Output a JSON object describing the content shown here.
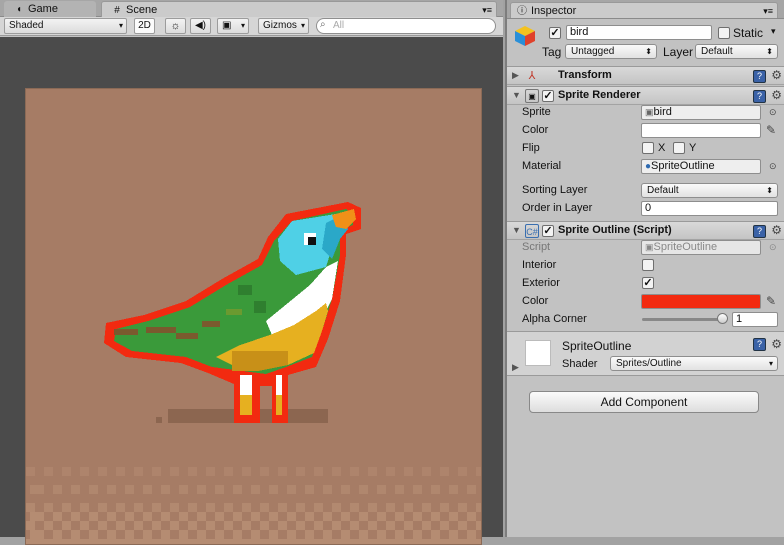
{
  "tabs": {
    "game": "Game",
    "scene": "Scene"
  },
  "scene_toolbar": {
    "shading_mode": "Shaded",
    "mode_2d": "2D",
    "gizmos": "Gizmos",
    "search_placeholder": "All"
  },
  "inspector": {
    "tab_title": "Inspector",
    "object": {
      "name": "bird",
      "active": true,
      "static_label": "Static",
      "static": false,
      "tag_label": "Tag",
      "tag_value": "Untagged",
      "layer_label": "Layer",
      "layer_value": "Default"
    },
    "transform": {
      "title": "Transform"
    },
    "sprite_renderer": {
      "title": "Sprite Renderer",
      "sprite_label": "Sprite",
      "sprite_value": "bird",
      "color_label": "Color",
      "color_value": "#ffffff",
      "flip_label": "Flip",
      "flip_x": "X",
      "flip_y": "Y",
      "material_label": "Material",
      "material_value": "SpriteOutline",
      "sorting_layer_label": "Sorting Layer",
      "sorting_layer_value": "Default",
      "order_label": "Order in Layer",
      "order_value": "0"
    },
    "sprite_outline": {
      "title": "Sprite Outline (Script)",
      "script_label": "Script",
      "script_value": "SpriteOutline",
      "interior_label": "Interior",
      "interior": false,
      "exterior_label": "Exterior",
      "exterior": true,
      "color_label": "Color",
      "color_value": "#f22a10",
      "alpha_corner_label": "Alpha Corner",
      "alpha_corner_value": "1"
    },
    "material": {
      "name": "SpriteOutline",
      "shader_label": "Shader",
      "shader_value": "Sprites/Outline"
    },
    "add_component": "Add Component"
  },
  "colors": {
    "scene_bg": "#a67c65",
    "outline": "#f22a10",
    "bird_green": "#3a9a3a",
    "bird_cyan": "#4fd0e6",
    "bird_yellow": "#e6b020",
    "beak": "#f09018"
  }
}
